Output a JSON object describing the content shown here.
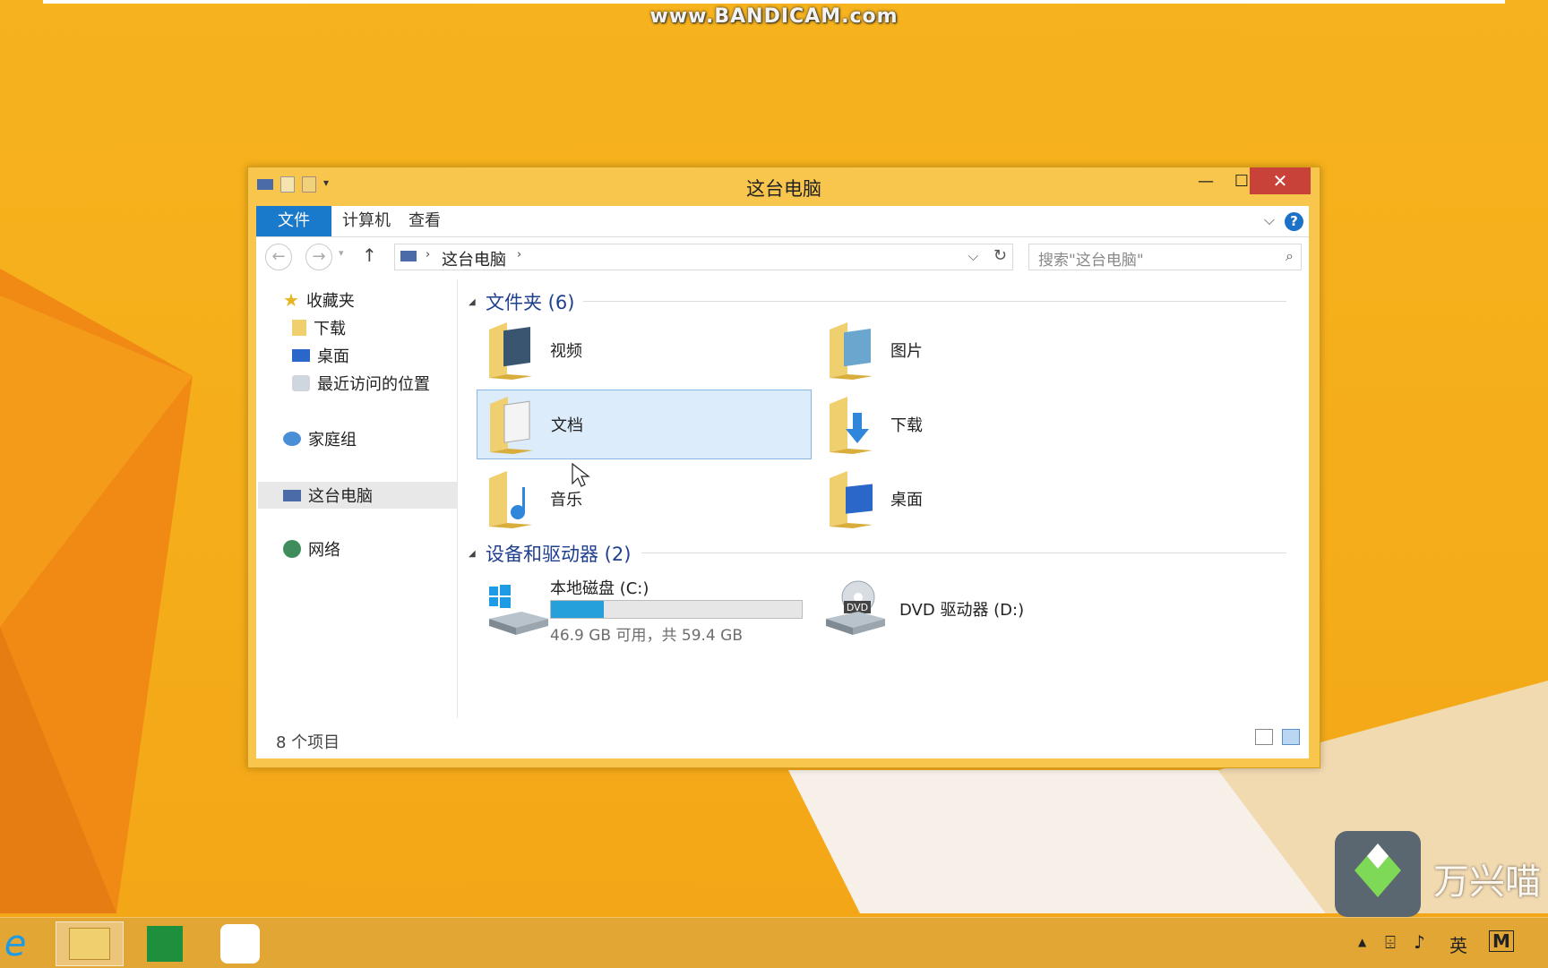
{
  "watermark": "www.BANDICAM.com",
  "window": {
    "title": "这台电脑"
  },
  "ribbon": {
    "tabs": [
      "文件",
      "计算机",
      "查看"
    ],
    "help": "?"
  },
  "address": {
    "crumb": "这台电脑",
    "search_placeholder": "搜索\"这台电脑\""
  },
  "nav": {
    "favorites": "收藏夹",
    "downloads": "下载",
    "desktop": "桌面",
    "recent": "最近访问的位置",
    "homegroup": "家庭组",
    "thispc": "这台电脑",
    "network": "网络"
  },
  "folders_group": "文件夹 (6)",
  "folders": [
    "视频",
    "图片",
    "文档",
    "下载",
    "音乐",
    "桌面"
  ],
  "devices_group": "设备和驱动器 (2)",
  "drive_c": {
    "name": "本地磁盘 (C:)",
    "space": "46.9 GB 可用，共 59.4 GB",
    "used_fraction": 0.21
  },
  "drive_d": {
    "name": "DVD 驱动器 (D:)",
    "badge": "DVD"
  },
  "status": {
    "count": "8 个项目"
  },
  "tray": {
    "ime": "英",
    "m": "M"
  },
  "brand": "万兴喵"
}
